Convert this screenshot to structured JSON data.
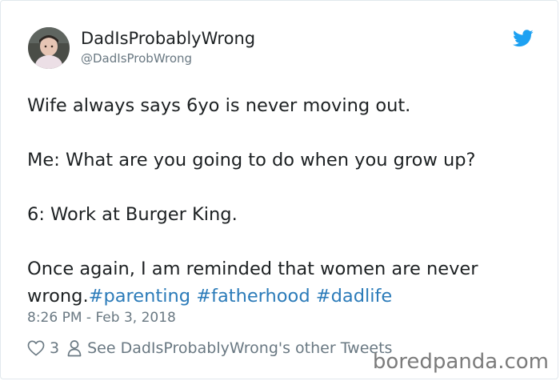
{
  "author": {
    "display_name": "DadIsProbablyWrong",
    "handle": "@DadIsProbWrong"
  },
  "tweet": {
    "line_1": "Wife always says 6yo is never moving out.",
    "line_2": "Me: What are you going to do when you grow up?",
    "line_3": "6: Work at Burger King.",
    "line_4": "Once again, I am reminded that women are never",
    "line_5": "wrong.",
    "hashtags": [
      "#parenting",
      "#fatherhood",
      "#dadlife"
    ]
  },
  "timestamp": "8:26 PM - Feb 3, 2018",
  "actions": {
    "like_count": "3",
    "other_tweets_label": "See DadIsProbablyWrong's other Tweets"
  },
  "watermark": "boredpanda.com",
  "colors": {
    "text": "#1c2022",
    "muted": "#697882",
    "link": "#2b7bb9",
    "twitter_blue": "#1da1f2"
  },
  "icons": {
    "brand": "twitter-bird-icon",
    "like": "heart-icon",
    "profile": "person-icon"
  }
}
